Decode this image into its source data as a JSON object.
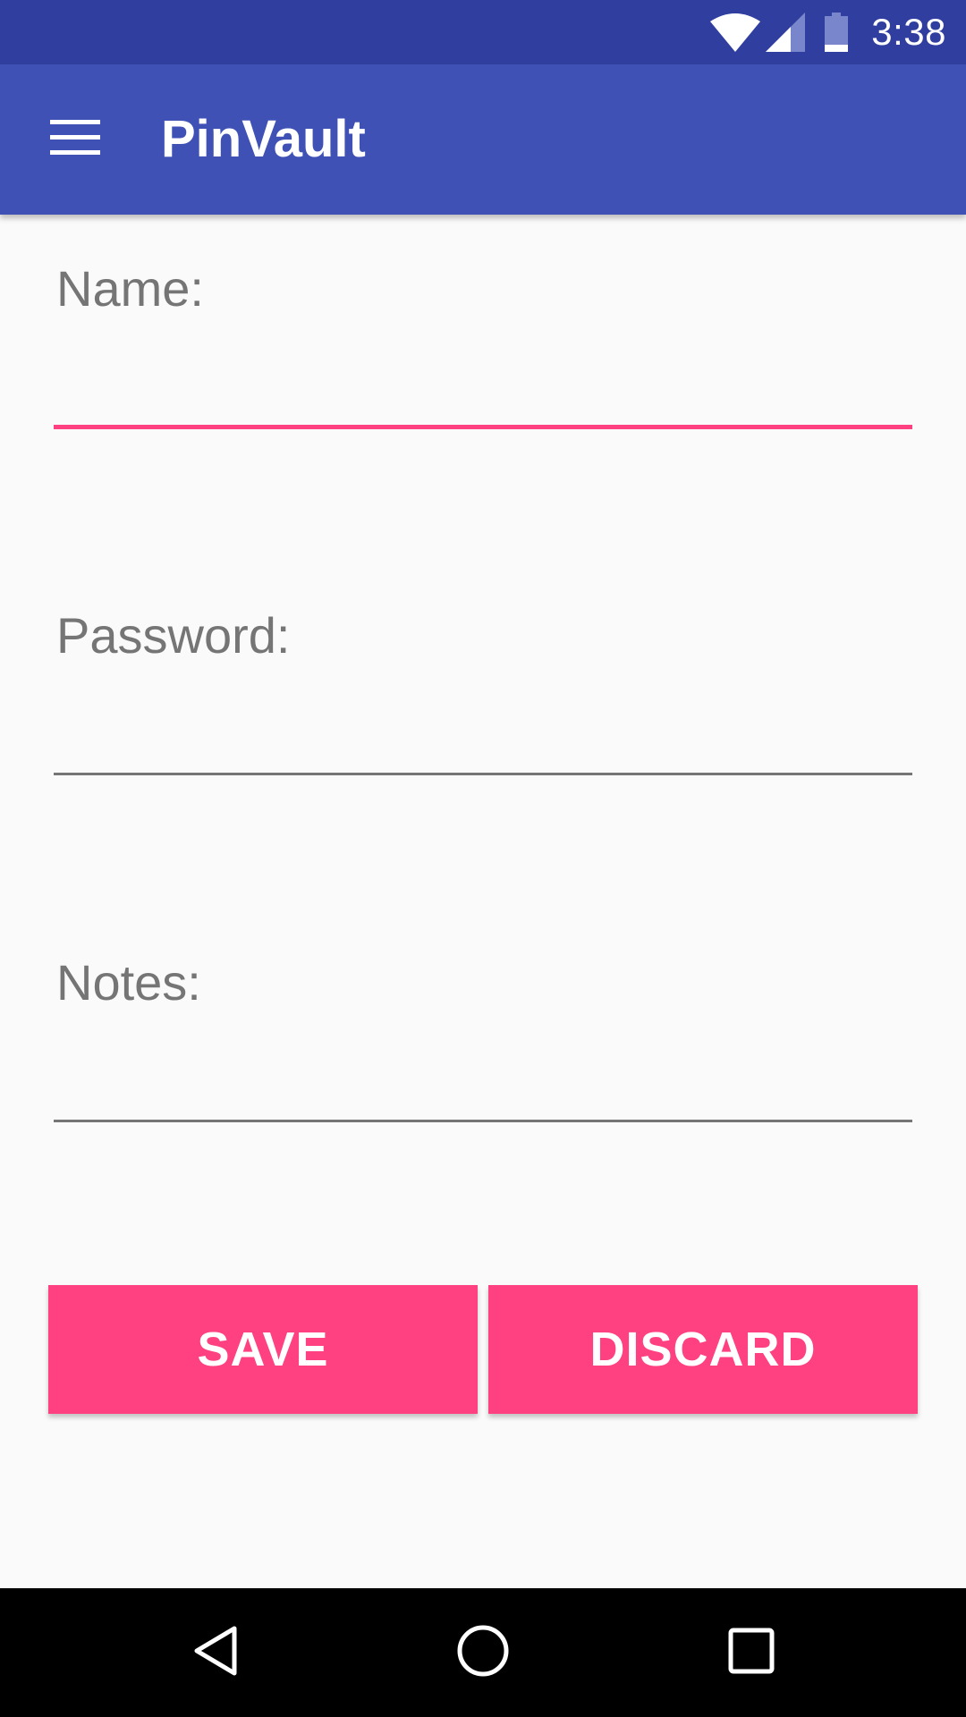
{
  "status_bar": {
    "time": "3:38",
    "icons": [
      "wifi-icon",
      "cell-signal-icon",
      "battery-icon"
    ]
  },
  "app_bar": {
    "title": "PinVault",
    "menu_icon": "hamburger-menu-icon"
  },
  "form": {
    "name_label": "Name:",
    "name_value": "",
    "password_label": "Password:",
    "password_value": "",
    "notes_label": "Notes:",
    "notes_value": ""
  },
  "actions": {
    "save_label": "SAVE",
    "discard_label": "DISCARD"
  },
  "nav_bar": {
    "icons": [
      "back-icon",
      "home-icon",
      "recents-icon"
    ]
  },
  "colors": {
    "status_bar": "#303f9f",
    "primary": "#3f51b5",
    "accent": "#ff4081",
    "label_text": "#757575",
    "background": "#fafafa",
    "nav_bar": "#000000"
  }
}
